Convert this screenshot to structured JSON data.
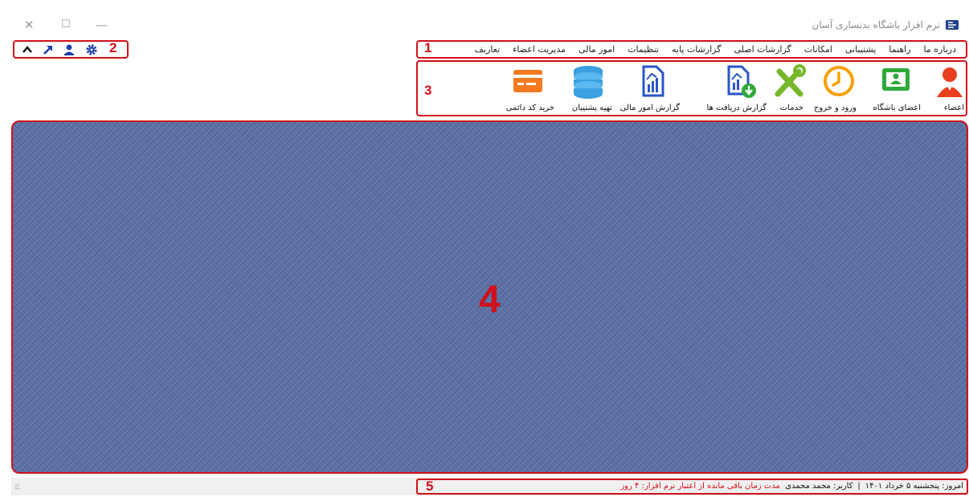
{
  "window": {
    "title": "نرم افزار باشگاه بدنسازی آسان",
    "controls": {
      "close": "✕",
      "maximize": "☐",
      "minimize": "—"
    }
  },
  "menu": {
    "items": [
      "تعاریف",
      "مدیریت اعضاء",
      "امور مالی",
      "تنظیمات",
      "گزارشات پایه",
      "گزارشات اصلی",
      "امکانات",
      "پشتیبانی",
      "راهنما",
      "درباره ما"
    ],
    "number": "1"
  },
  "quickbar": {
    "number": "2",
    "buttons": [
      "collapse-chevron-icon",
      "external-arrow-icon",
      "user-icon",
      "settings-gear-icon"
    ]
  },
  "ribbon": {
    "number": "3",
    "buttons": [
      {
        "label": "اعضاء",
        "icon": "member-avatar-icon"
      },
      {
        "label": "اعضای باشگاه",
        "icon": "club-members-icon"
      },
      {
        "label": "ورود و خروج",
        "icon": "clock-icon"
      },
      {
        "label": "خدمات",
        "icon": "tools-icon"
      },
      {
        "label": "گزارش دریافت ها",
        "icon": "report-download-icon"
      },
      {
        "label": "گزارش امور مالی",
        "icon": "financial-report-icon"
      },
      {
        "label": "تهیه پشتیبان",
        "icon": "database-icon"
      },
      {
        "label": "خرید کد دائمی",
        "icon": "credit-card-icon"
      }
    ]
  },
  "main": {
    "number": "4"
  },
  "status": {
    "number": "5",
    "today": "امروز: پنجشنبه ۵ خرداد ۱۴۰۱",
    "separator": "|",
    "user": "کاربر: محمد محمدی",
    "remaining": "مدت زمان باقی مانده از اعتبار نرم افزار: ۴ روز"
  },
  "colors": {
    "annotation_red": "#d0101a",
    "main_background": "#5a70a8",
    "accent_blue": "#2a55c8",
    "accent_orange": "#f5a000",
    "accent_green": "#2eaa3c"
  }
}
